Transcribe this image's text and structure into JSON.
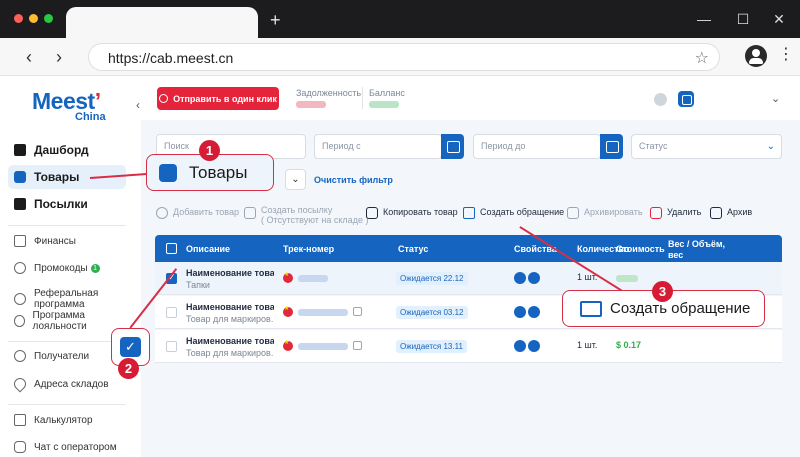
{
  "browser": {
    "url": "https://cab.meest.cn",
    "new_tab": "+",
    "minimize": "—",
    "maximize": "☐",
    "close": "✕",
    "back": "‹",
    "forward": "›",
    "bookmark": "☆",
    "menu": "⋮"
  },
  "brand": {
    "name": "Meest",
    "sub": "China",
    "collapse": "‹"
  },
  "sidebar": {
    "items": [
      {
        "label": "Дашборд"
      },
      {
        "label": "Товары"
      },
      {
        "label": "Посылки"
      },
      {
        "label": "Финансы"
      },
      {
        "label": "Промокоды",
        "badge": "1"
      },
      {
        "label": "Реферальная программа"
      },
      {
        "label": "Программа лояльности"
      },
      {
        "label": "Получатели"
      },
      {
        "label": "Адреса складов"
      },
      {
        "label": "Калькулятор"
      },
      {
        "label": "Чат с оператором"
      }
    ]
  },
  "header": {
    "send_button": "Отправить в один клик",
    "debt_label": "Задолженность",
    "balance_label": "Балланс",
    "user_chevron": "⌄"
  },
  "filters": {
    "search_placeholder": "Поиск",
    "period_from": "Период с",
    "period_to": "Период до",
    "status": "Статус",
    "clear": "Очистить фильтр",
    "select_chevron": "⌄"
  },
  "toolbar": {
    "add_product": "Добавить товар",
    "create_parcel": "Создать посылку",
    "create_parcel_note": "( Отсутствуют на складе )",
    "copy_product": "Копировать товар",
    "create_request": "Создать обращение",
    "archive_action": "Архивировать",
    "delete": "Удалить",
    "archive": "Архив"
  },
  "table": {
    "columns": [
      "Описание",
      "Трек-номер",
      "Статус",
      "Свойства",
      "Количество",
      "Стоимость",
      "Вес / Объём, вес"
    ],
    "rows": [
      {
        "title": "Наименование това...",
        "subtitle": "Тапки",
        "status": "Ожидается 22.12",
        "qty": "1 шт.",
        "price": "",
        "selected": true
      },
      {
        "title": "Наименование това...",
        "subtitle": "Товар для маркиров...",
        "status": "Ожидается 03.12",
        "qty": "",
        "price": "",
        "selected": false
      },
      {
        "title": "Наименование това...",
        "subtitle": "Товар для маркиров...",
        "status": "Ожидается 13.11",
        "qty": "1 шт.",
        "price": "$ 0.17",
        "selected": false
      }
    ]
  },
  "callouts": {
    "one": {
      "number": "1",
      "label": "Товары"
    },
    "two": {
      "number": "2"
    },
    "three": {
      "number": "3",
      "label": "Создать обращение"
    }
  },
  "colors": {
    "brand_blue": "#1565c0",
    "accent_red": "#e5243b",
    "callout_red": "#d81b35",
    "success_green": "#2fae4e"
  }
}
